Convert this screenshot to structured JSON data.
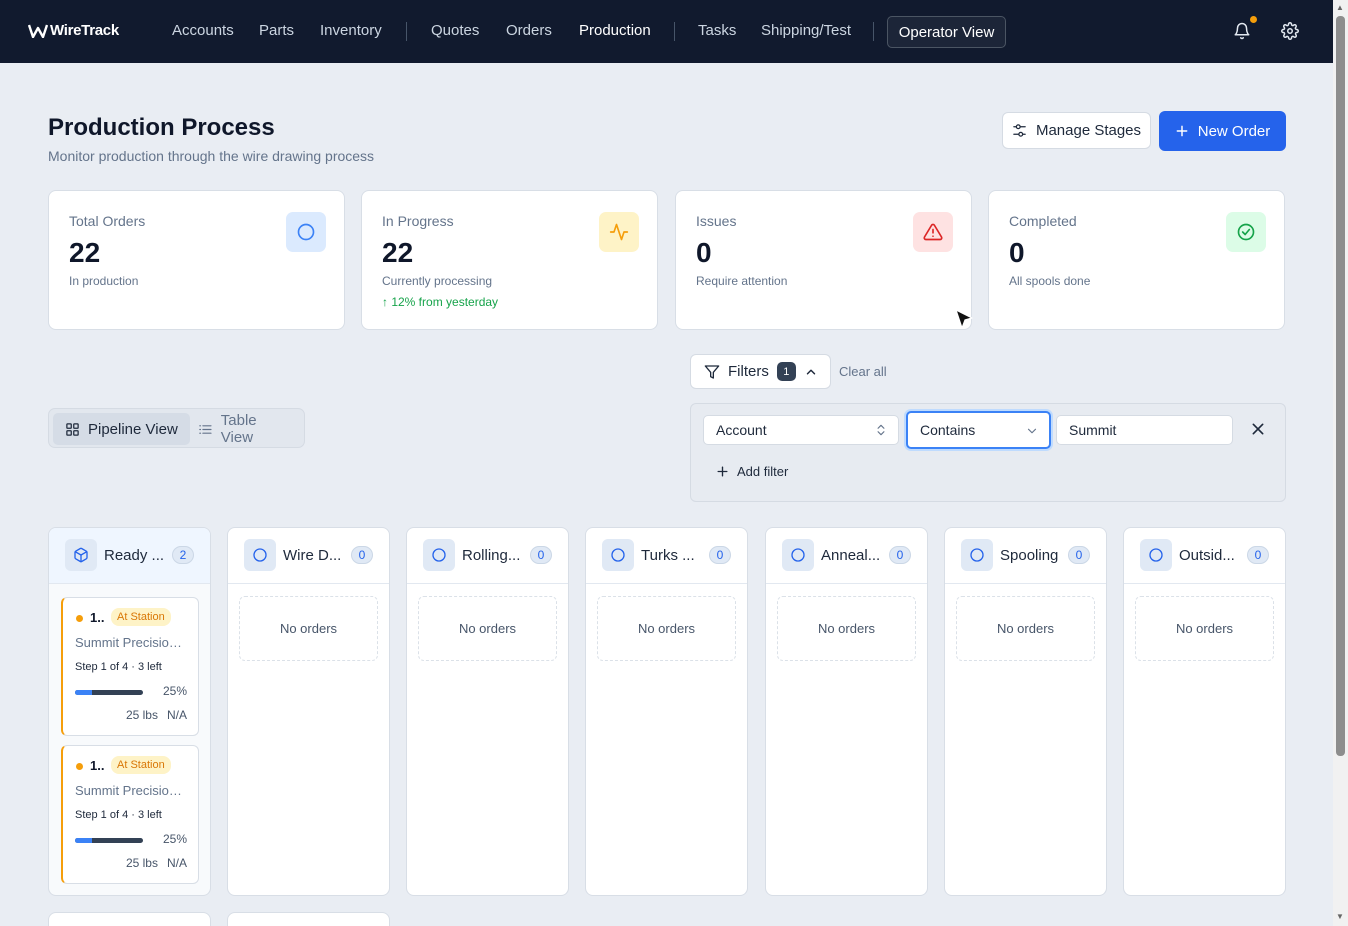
{
  "app": {
    "name": "WireTrack"
  },
  "nav": {
    "items": [
      {
        "key": "accounts",
        "label": "Accounts"
      },
      {
        "key": "parts",
        "label": "Parts"
      },
      {
        "key": "inventory",
        "label": "Inventory"
      },
      {
        "key": "quotes",
        "label": "Quotes"
      },
      {
        "key": "orders",
        "label": "Orders"
      },
      {
        "key": "production",
        "label": "Production"
      },
      {
        "key": "tasks",
        "label": "Tasks"
      },
      {
        "key": "shipping",
        "label": "Shipping/Test"
      }
    ],
    "operator_view": "Operator View",
    "icons": [
      "bell-icon",
      "gear-icon"
    ],
    "notification_color": "#f59e0b"
  },
  "header": {
    "title": "Production Process",
    "subtitle": "Monitor production through the wire drawing process",
    "manage_stages": "Manage Stages",
    "new_order": "New Order"
  },
  "stats": [
    {
      "label": "Total Orders",
      "value": "22",
      "sub": "In production",
      "trend": "",
      "icon": "circle-icon",
      "color": "#3b82f6"
    },
    {
      "label": "In Progress",
      "value": "22",
      "sub": "Currently processing",
      "trend": "↑ 12% from yesterday",
      "icon": "activity-icon",
      "color": "#f59e0b"
    },
    {
      "label": "Issues",
      "value": "0",
      "sub": "Require attention",
      "trend": "",
      "icon": "alert-triangle-icon",
      "color": "#dc2626"
    },
    {
      "label": "Completed",
      "value": "0",
      "sub": "All spools done",
      "trend": "",
      "icon": "check-circle-icon",
      "color": "#16a34a"
    }
  ],
  "filters": {
    "label": "Filters",
    "count": "1",
    "clear_all": "Clear all",
    "field": "Account",
    "operator": "Contains",
    "value": "Summit",
    "add_filter": "Add filter"
  },
  "view_toggle": {
    "pipeline": "Pipeline View",
    "table": "Table View",
    "active": "pipeline"
  },
  "columns": [
    {
      "title": "Ready ...",
      "count": "2",
      "icon": "package-icon",
      "orders": [
        {
          "id": "1...",
          "status": "At Station",
          "account": "Summit Precision ...",
          "step": "Step 1 of 4 · 3 left",
          "progress": 0.25,
          "progress_label": "25%",
          "weight": "25 lbs",
          "extra": "N/A"
        },
        {
          "id": "1...",
          "status": "At Station",
          "account": "Summit Precision ...",
          "step": "Step 1 of 4 · 3 left",
          "progress": 0.25,
          "progress_label": "25%",
          "weight": "25 lbs",
          "extra": "N/A"
        }
      ]
    },
    {
      "title": "Wire D...",
      "count": "0",
      "icon": "circle-icon",
      "empty": "No orders"
    },
    {
      "title": "Rolling...",
      "count": "0",
      "icon": "circle-icon",
      "empty": "No orders"
    },
    {
      "title": "Turks ...",
      "count": "0",
      "icon": "circle-icon",
      "empty": "No orders"
    },
    {
      "title": "Anneal...",
      "count": "0",
      "icon": "circle-icon",
      "empty": "No orders"
    },
    {
      "title": "Spooling",
      "count": "0",
      "icon": "circle-icon",
      "empty": "No orders"
    },
    {
      "title": "Outsid...",
      "count": "0",
      "icon": "circle-icon",
      "empty": "No orders"
    }
  ]
}
